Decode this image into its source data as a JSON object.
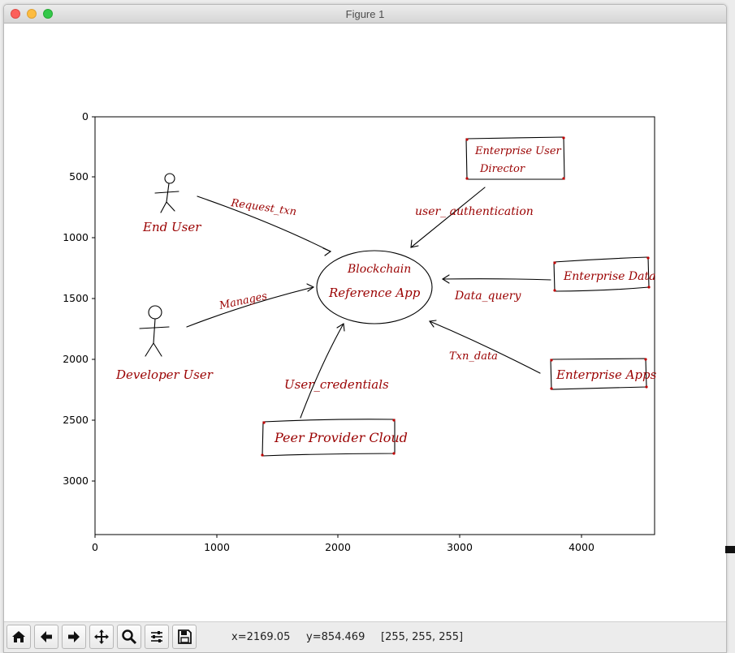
{
  "window": {
    "title": "Figure 1"
  },
  "plot": {
    "x_ticks": [
      "0",
      "1000",
      "2000",
      "3000",
      "4000"
    ],
    "y_ticks": [
      "0",
      "500",
      "1000",
      "1500",
      "2000",
      "2500",
      "3000"
    ],
    "image": {
      "end_user": "End User",
      "developer_user": "Developer User",
      "request": "Request_txn",
      "manages": "Manages",
      "hub_line1": "Blockchain",
      "hub_line2": "Reference App",
      "user_auth": "user_ authentication",
      "dir_line1": "Enterprise User",
      "dir_line2": "Director",
      "ent_data": "Enterprise Data",
      "data_query": "Data_query",
      "txn_data": "Txn_data",
      "ent_apps": "Enterprise Apps",
      "user_cred": "User_credentials",
      "peer": "Peer Provider Cloud"
    }
  },
  "toolbar": {
    "buttons": [
      "home-icon",
      "back-arrow-icon",
      "forward-arrow-icon",
      "pan-icon",
      "zoom-icon",
      "configure-icon",
      "save-icon"
    ]
  },
  "status": {
    "x": "x=2169.05",
    "y": "y=854.469",
    "rgb": "[255, 255, 255]"
  },
  "colors": {
    "ink": "#000000",
    "handwriting": "#9a0000",
    "canvas": "#ffffff"
  }
}
